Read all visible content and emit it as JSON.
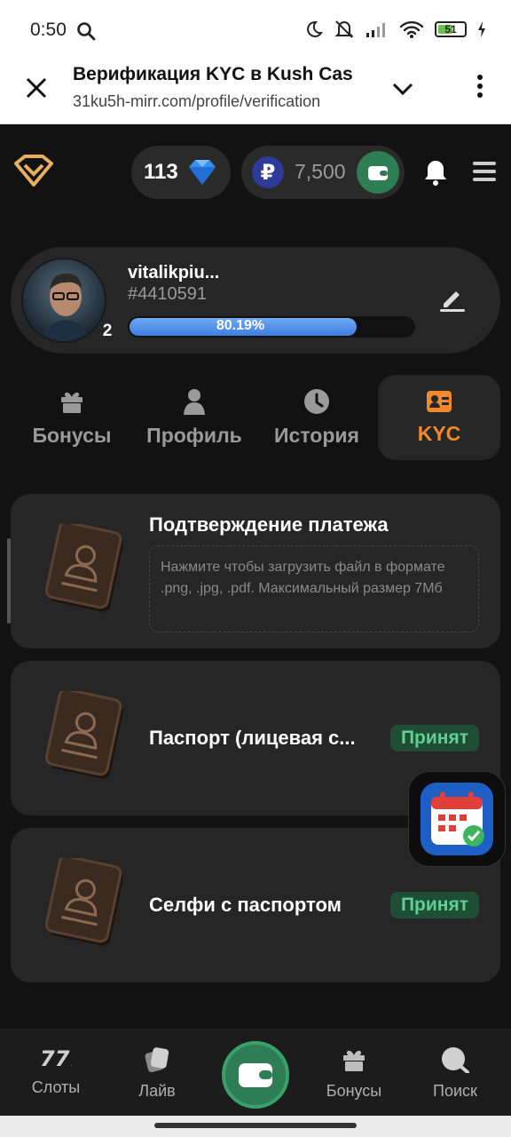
{
  "statusbar": {
    "time": "0:50",
    "battery": "51"
  },
  "browser": {
    "title": "Верификация KYC в Kush Cas",
    "url": "31ku5h-mirr.com/profile/verification"
  },
  "header": {
    "gems": "113",
    "currency_symbol": "₽",
    "balance": "7,500"
  },
  "profile": {
    "username": "vitalikpiu...",
    "user_id": "#4410591",
    "level": "2",
    "progress_label": "80.19%",
    "progress_value": 0.8019
  },
  "tabs": [
    {
      "label": "Бонусы",
      "icon": "gift-icon"
    },
    {
      "label": "Профиль",
      "icon": "user-icon"
    },
    {
      "label": "История",
      "icon": "clock-icon"
    },
    {
      "label": "KYC",
      "icon": "id-card-icon",
      "active": true
    }
  ],
  "kyc": [
    {
      "title": "Подтверждение платежа",
      "hint": "Нажмите чтобы загрузить файл в формате .png, .jpg, .pdf. Максимальный размер 7Мб"
    },
    {
      "title": "Паспорт (лицевая с...",
      "status": "Принят"
    },
    {
      "title": "Селфи с паспортом",
      "status": "Принят"
    }
  ],
  "bottom_nav": [
    {
      "label": "Слоты",
      "icon": "slots-icon"
    },
    {
      "label": "Лайв",
      "icon": "cards-icon"
    },
    {
      "label": "",
      "icon": "wallet-icon"
    },
    {
      "label": "Бонусы",
      "icon": "gift-icon"
    },
    {
      "label": "Поиск",
      "icon": "search-icon"
    }
  ],
  "colors": {
    "accent": "#f08a2c",
    "green": "#2e7d55",
    "bg": "#121212",
    "card": "#262626",
    "progress": "#4a86e8"
  }
}
